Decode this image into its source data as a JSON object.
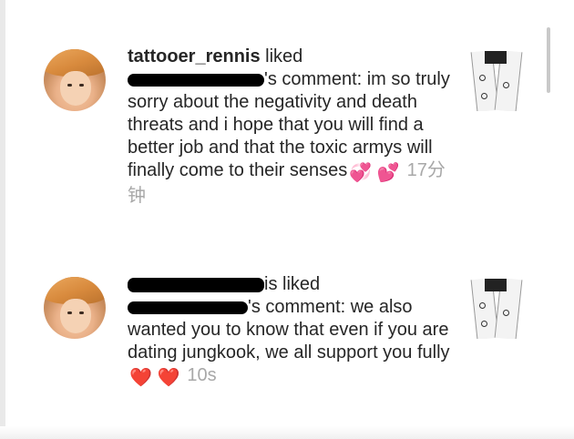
{
  "notifications": [
    {
      "username": "tattooer_rennis",
      "action_text": " liked",
      "comment_prefix": "'s comment: ",
      "comment_text": "im so truly sorry about the negativity and death threats and i hope that you will find a better job and that the toxic armys will finally come to their senses",
      "emoji": "💞 💕",
      "timestamp": "17分钟"
    },
    {
      "action_text": "is liked",
      "comment_prefix": "'s comment: ",
      "comment_text": "we also wanted you to know that even if you are dating jungkook, we all support you fully",
      "emoji": "❤️ ❤️",
      "timestamp": "10s"
    }
  ],
  "icons": {
    "avatar": "profile-photo",
    "thumbnail": "post-thumbnail-tattooed-arms"
  }
}
